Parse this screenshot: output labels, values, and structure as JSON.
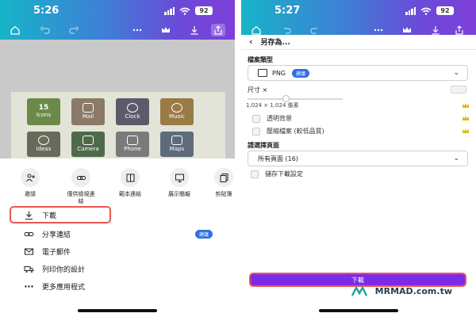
{
  "left_phone": {
    "status": {
      "time": "5:26",
      "battery": "92"
    },
    "design_tiles": [
      {
        "title": "15",
        "subtitle": "Icons",
        "color": "#6b8a4a"
      },
      {
        "title": "",
        "subtitle": "Mail",
        "color": "#8b7a66"
      },
      {
        "title": "",
        "subtitle": "Clock",
        "color": "#5f5a6b"
      },
      {
        "title": "",
        "subtitle": "Music",
        "color": "#9a7a45"
      },
      {
        "title": "",
        "subtitle": "Ideas",
        "color": "#6a6a5a"
      },
      {
        "title": "",
        "subtitle": "Camera",
        "color": "#4f6a4a"
      },
      {
        "title": "",
        "subtitle": "Phone",
        "color": "#7a7a7a"
      },
      {
        "title": "",
        "subtitle": "Maps",
        "color": "#5d6b7d"
      }
    ],
    "share_items": [
      {
        "label": "邀請",
        "icon": "add-people-icon"
      },
      {
        "label": "僅供檢視連\n結",
        "icon": "link-icon"
      },
      {
        "label": "範本連結",
        "icon": "template-icon"
      },
      {
        "label": "展示簡報",
        "icon": "present-icon"
      },
      {
        "label": "剪貼簿",
        "icon": "copy-icon"
      }
    ],
    "menu": [
      {
        "label": "下載",
        "icon": "download-icon"
      },
      {
        "label": "分享連結",
        "icon": "share-link-icon",
        "badge": "建議"
      },
      {
        "label": "電子郵件",
        "icon": "mail-icon"
      },
      {
        "label": "列印你的設計",
        "icon": "print-truck-icon"
      },
      {
        "label": "更多應用程式",
        "icon": "more-icon"
      }
    ]
  },
  "right_phone": {
    "status": {
      "time": "5:27",
      "battery": "92"
    },
    "panel_title": "另存為...",
    "file_type_label": "檔案類型",
    "file_type_value": "PNG",
    "file_type_badge": "建議",
    "size_label": "尺寸 ×",
    "size_hint": "1,024 × 1,024 像素",
    "options": [
      {
        "label": "透明背景"
      },
      {
        "label": "壓縮檔案 (較低品質)"
      }
    ],
    "pages_label": "請選擇頁面",
    "pages_value": "所有頁面 (16)",
    "save_settings_label": "儲存下載設定",
    "download_button": "下載",
    "watermark": "MRMAD.com.tw"
  },
  "colors": {
    "accent_purple": "#7d2ae8",
    "highlight_red": "#e8584f",
    "badge_blue": "#2f6fe5",
    "crown_gold": "#e6b422"
  }
}
